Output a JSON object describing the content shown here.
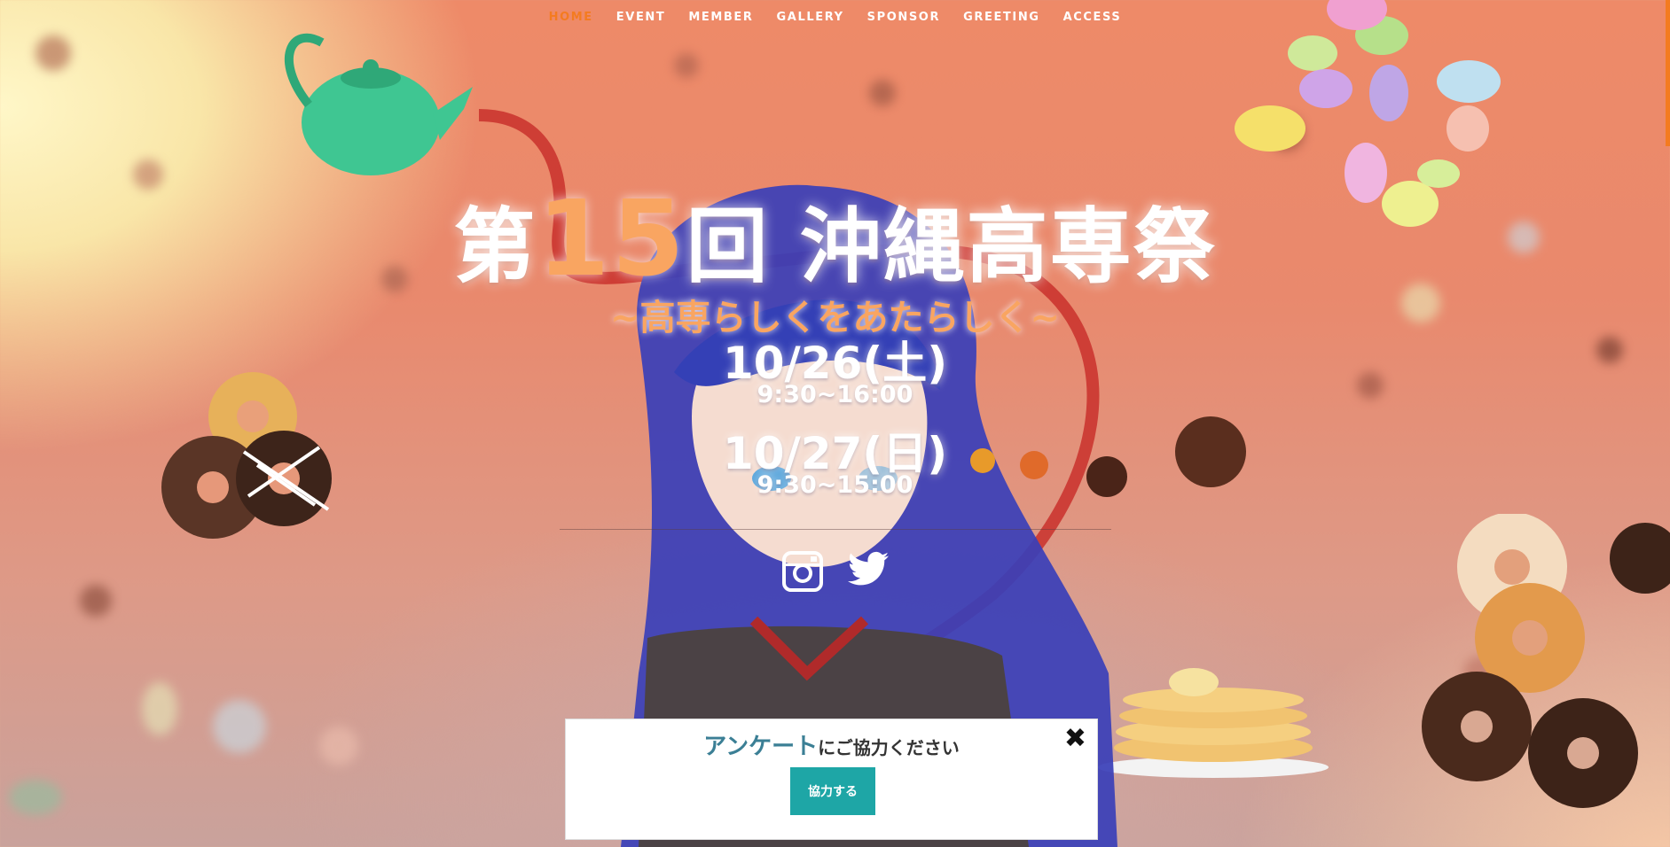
{
  "nav": {
    "items": [
      {
        "label": "HOME",
        "active": true
      },
      {
        "label": "EVENT"
      },
      {
        "label": "MEMBER"
      },
      {
        "label": "GALLERY"
      },
      {
        "label": "SPONSOR"
      },
      {
        "label": "GREETING"
      },
      {
        "label": "ACCESS"
      }
    ]
  },
  "hero": {
    "title_prefix": "第",
    "title_number": "15",
    "title_suffix": "回 沖縄高専祭",
    "subtitle": "~高専らしくをあたらしく~",
    "dates": [
      {
        "day": "10/26(土)",
        "time": "9:30~16:00"
      },
      {
        "day": "10/27(日)",
        "time": "9:30~15:00"
      }
    ]
  },
  "social": {
    "icons": [
      "instagram-icon",
      "twitter-icon"
    ]
  },
  "survey": {
    "title_highlight": "アンケート",
    "title_rest": "にご協力ください",
    "close_label": "✖",
    "button_label": "協力する"
  },
  "colors": {
    "accent": "#f47b20",
    "title_number": "#f9a561",
    "survey_button": "#1ea6a6",
    "survey_highlight": "#3b7f95"
  }
}
